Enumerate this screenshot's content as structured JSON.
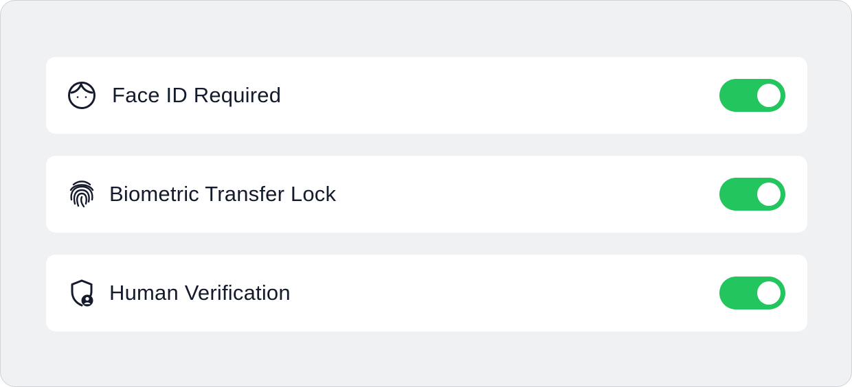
{
  "settings": [
    {
      "label": "Face ID Required",
      "icon": "face-id-icon",
      "enabled": true
    },
    {
      "label": "Biometric Transfer Lock",
      "icon": "fingerprint-icon",
      "enabled": true
    },
    {
      "label": "Human Verification",
      "icon": "shield-user-icon",
      "enabled": true
    }
  ],
  "colors": {
    "panel_background": "#f0f1f3",
    "card_background": "#ffffff",
    "toggle_on": "#22c55e",
    "text": "#141b2d"
  }
}
